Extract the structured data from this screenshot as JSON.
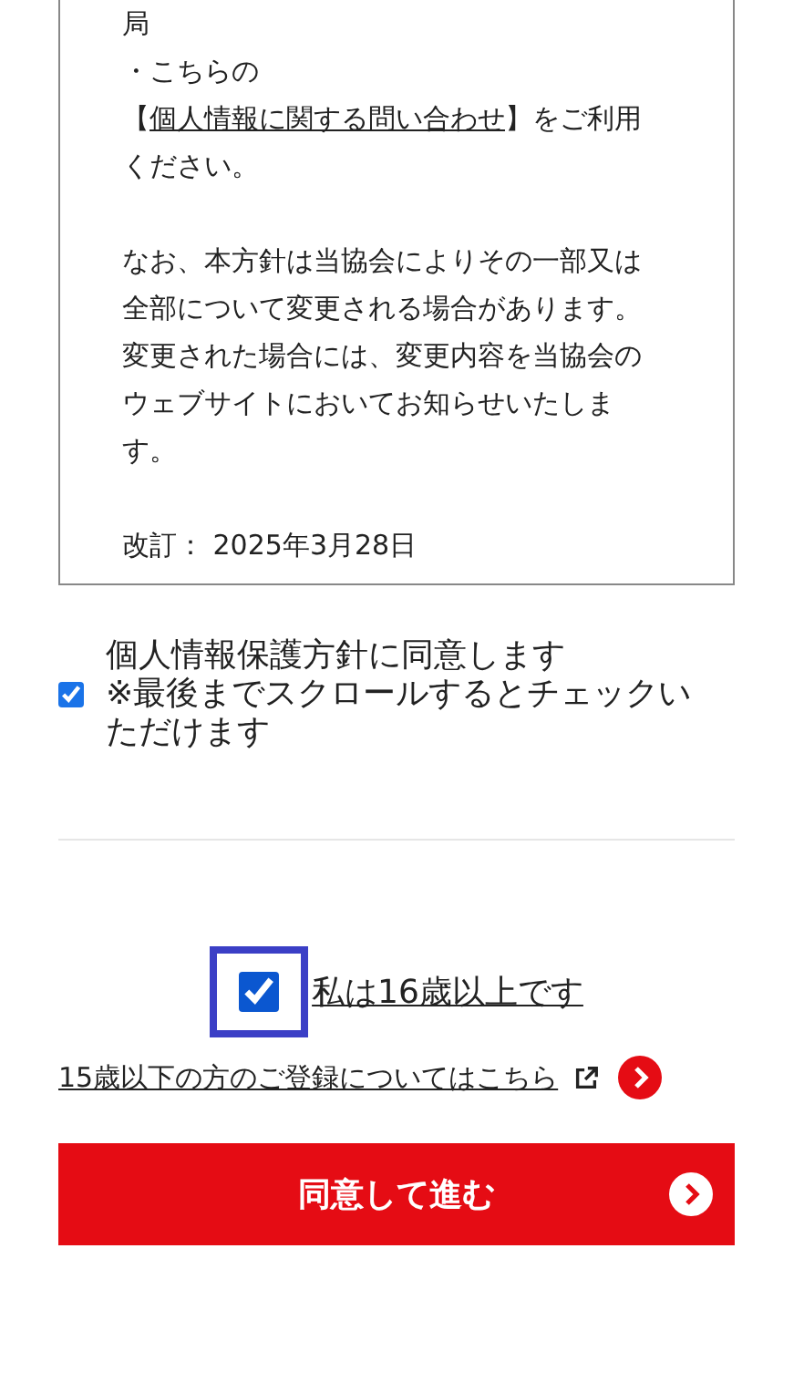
{
  "policy": {
    "sections": [
      {
        "paragraphs": [
          [
            {
              "text": "局",
              "link": false
            }
          ],
          [
            {
              "text": "・こちらの【",
              "link": false
            },
            {
              "text": "個人情報に関する問い合わせ",
              "link": true
            },
            {
              "text": "】をご利用ください。",
              "link": false
            }
          ]
        ]
      },
      {
        "paragraphs": [
          [
            {
              "text": "なお、本方針は当協会によりその一部又は全部について変更される場合があります。変更された場合には、変更内容を当協会のウェブサイトにおいてお知らせいたします。",
              "link": false
            }
          ]
        ]
      },
      {
        "paragraphs": [
          [
            {
              "text": "改訂： 2025年3月28日",
              "link": false
            }
          ]
        ]
      }
    ]
  },
  "agree": {
    "checked": true,
    "label": "個人情報保護方針に同意します",
    "note": "※最後までスクロールするとチェックいただけます"
  },
  "age": {
    "checked": true,
    "focused": true,
    "label": "私は16歳以上です"
  },
  "under_age_link": "15歳以下の方のご登録についてはこちら",
  "submit": "同意して進む"
}
